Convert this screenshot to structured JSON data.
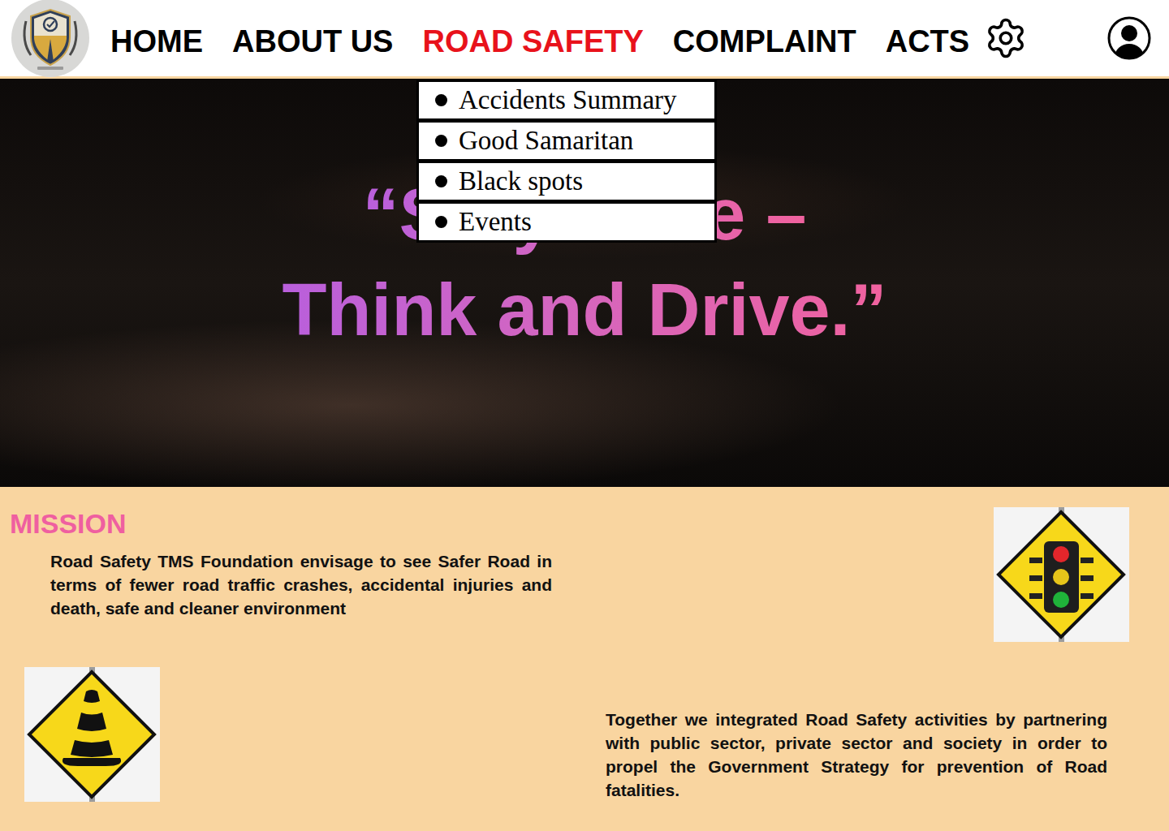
{
  "nav": {
    "items": [
      {
        "label": "HOME",
        "selected": false
      },
      {
        "label": "ABOUT US",
        "selected": false
      },
      {
        "label": "ROAD SAFETY",
        "selected": true
      },
      {
        "label": "COMPLAINT",
        "selected": false
      },
      {
        "label": "ACTS",
        "selected": false
      }
    ]
  },
  "dropdown": {
    "items": [
      "Accidents Summary",
      "Good Samaritan",
      "Black spots",
      "Events"
    ]
  },
  "hero": {
    "lines": [
      "“Stay Alive –",
      "Think and Drive.”"
    ]
  },
  "mission": {
    "title": "MISSION",
    "text": "Road Safety TMS Foundation envisage to see Safer Road in terms of fewer road traffic crashes, accidental injuries and death, safe and cleaner environment"
  },
  "together": {
    "text": "Together we integrated Road Safety activities by partnering with public sector, private sector and society in order to propel the Government Strategy for prevention of Road fatalities."
  }
}
